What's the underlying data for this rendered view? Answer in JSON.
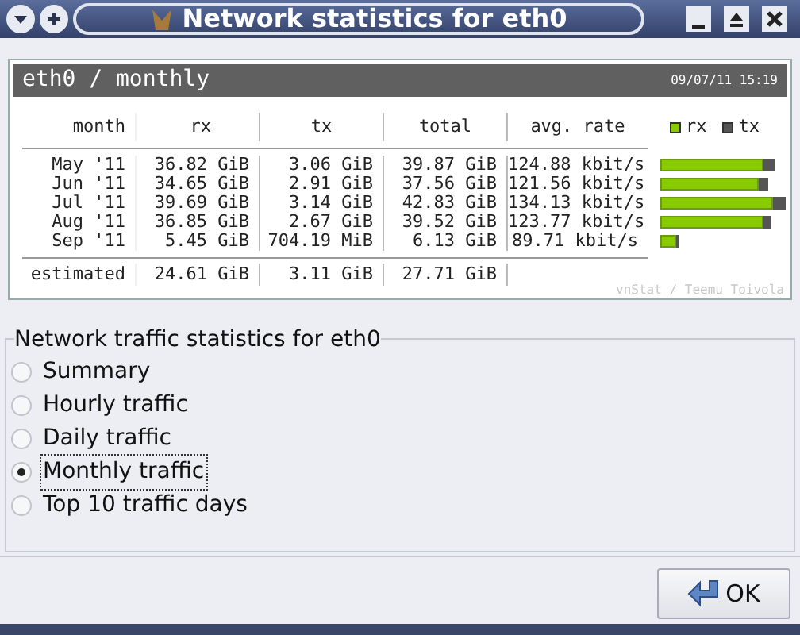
{
  "window": {
    "title": "Network statistics for eth0"
  },
  "report": {
    "title": "eth0 / monthly",
    "timestamp": "09/07/11 15:19",
    "legend": [
      "rx",
      "tx"
    ],
    "columns": [
      "month",
      "rx",
      "tx",
      "total",
      "avg. rate"
    ],
    "rows": [
      {
        "cells": [
          "May '11",
          "36.82 GiB",
          "3.06 GiB",
          "39.87 GiB",
          "124.88 kbit/s"
        ]
      },
      {
        "cells": [
          "Jun '11",
          "34.65 GiB",
          "2.91 GiB",
          "37.56 GiB",
          "121.56 kbit/s"
        ]
      },
      {
        "cells": [
          "Jul '11",
          "39.69 GiB",
          "3.14 GiB",
          "42.83 GiB",
          "134.13 kbit/s"
        ]
      },
      {
        "cells": [
          "Aug '11",
          "36.85 GiB",
          "2.67 GiB",
          "39.52 GiB",
          "123.77 kbit/s"
        ]
      },
      {
        "cells": [
          "Sep '11",
          "5.45 GiB",
          "704.19 MiB",
          "6.13 GiB",
          "89.71 kbit/s"
        ]
      }
    ],
    "estimated": [
      "estimated",
      "24.61 GiB",
      "3.11 GiB",
      "27.71 GiB"
    ],
    "credit": "vnStat / Teemu Toivola"
  },
  "options": {
    "title": "Network traffic statistics for eth0",
    "items": [
      {
        "label": "Summary",
        "selected": false
      },
      {
        "label": "Hourly traffic",
        "selected": false
      },
      {
        "label": "Daily traffic",
        "selected": false
      },
      {
        "label": "Monthly traffic",
        "selected": true
      },
      {
        "label": "Top 10 traffic days",
        "selected": false
      }
    ]
  },
  "buttons": [
    "OK"
  ]
}
